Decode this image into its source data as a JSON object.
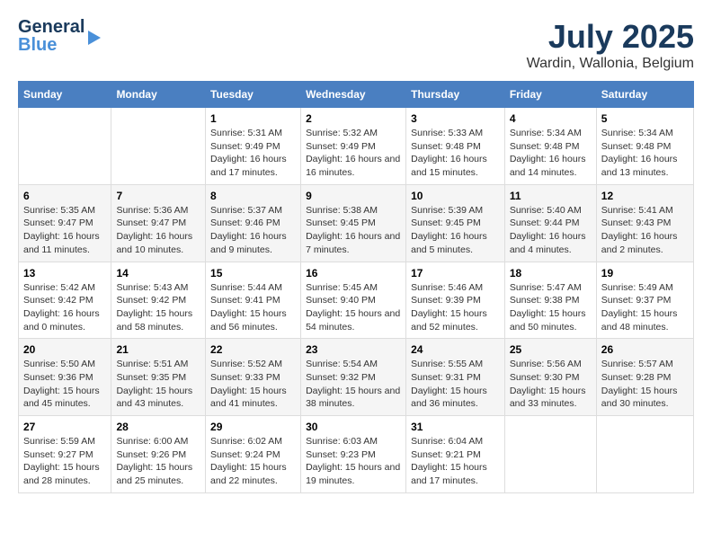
{
  "logo": {
    "general": "General",
    "blue": "Blue"
  },
  "title": "July 2025",
  "subtitle": "Wardin, Wallonia, Belgium",
  "days": [
    "Sunday",
    "Monday",
    "Tuesday",
    "Wednesday",
    "Thursday",
    "Friday",
    "Saturday"
  ],
  "weeks": [
    [
      {
        "day": "",
        "content": ""
      },
      {
        "day": "",
        "content": ""
      },
      {
        "day": "1",
        "content": "Sunrise: 5:31 AM\nSunset: 9:49 PM\nDaylight: 16 hours and 17 minutes."
      },
      {
        "day": "2",
        "content": "Sunrise: 5:32 AM\nSunset: 9:49 PM\nDaylight: 16 hours and 16 minutes."
      },
      {
        "day": "3",
        "content": "Sunrise: 5:33 AM\nSunset: 9:48 PM\nDaylight: 16 hours and 15 minutes."
      },
      {
        "day": "4",
        "content": "Sunrise: 5:34 AM\nSunset: 9:48 PM\nDaylight: 16 hours and 14 minutes."
      },
      {
        "day": "5",
        "content": "Sunrise: 5:34 AM\nSunset: 9:48 PM\nDaylight: 16 hours and 13 minutes."
      }
    ],
    [
      {
        "day": "6",
        "content": "Sunrise: 5:35 AM\nSunset: 9:47 PM\nDaylight: 16 hours and 11 minutes."
      },
      {
        "day": "7",
        "content": "Sunrise: 5:36 AM\nSunset: 9:47 PM\nDaylight: 16 hours and 10 minutes."
      },
      {
        "day": "8",
        "content": "Sunrise: 5:37 AM\nSunset: 9:46 PM\nDaylight: 16 hours and 9 minutes."
      },
      {
        "day": "9",
        "content": "Sunrise: 5:38 AM\nSunset: 9:45 PM\nDaylight: 16 hours and 7 minutes."
      },
      {
        "day": "10",
        "content": "Sunrise: 5:39 AM\nSunset: 9:45 PM\nDaylight: 16 hours and 5 minutes."
      },
      {
        "day": "11",
        "content": "Sunrise: 5:40 AM\nSunset: 9:44 PM\nDaylight: 16 hours and 4 minutes."
      },
      {
        "day": "12",
        "content": "Sunrise: 5:41 AM\nSunset: 9:43 PM\nDaylight: 16 hours and 2 minutes."
      }
    ],
    [
      {
        "day": "13",
        "content": "Sunrise: 5:42 AM\nSunset: 9:42 PM\nDaylight: 16 hours and 0 minutes."
      },
      {
        "day": "14",
        "content": "Sunrise: 5:43 AM\nSunset: 9:42 PM\nDaylight: 15 hours and 58 minutes."
      },
      {
        "day": "15",
        "content": "Sunrise: 5:44 AM\nSunset: 9:41 PM\nDaylight: 15 hours and 56 minutes."
      },
      {
        "day": "16",
        "content": "Sunrise: 5:45 AM\nSunset: 9:40 PM\nDaylight: 15 hours and 54 minutes."
      },
      {
        "day": "17",
        "content": "Sunrise: 5:46 AM\nSunset: 9:39 PM\nDaylight: 15 hours and 52 minutes."
      },
      {
        "day": "18",
        "content": "Sunrise: 5:47 AM\nSunset: 9:38 PM\nDaylight: 15 hours and 50 minutes."
      },
      {
        "day": "19",
        "content": "Sunrise: 5:49 AM\nSunset: 9:37 PM\nDaylight: 15 hours and 48 minutes."
      }
    ],
    [
      {
        "day": "20",
        "content": "Sunrise: 5:50 AM\nSunset: 9:36 PM\nDaylight: 15 hours and 45 minutes."
      },
      {
        "day": "21",
        "content": "Sunrise: 5:51 AM\nSunset: 9:35 PM\nDaylight: 15 hours and 43 minutes."
      },
      {
        "day": "22",
        "content": "Sunrise: 5:52 AM\nSunset: 9:33 PM\nDaylight: 15 hours and 41 minutes."
      },
      {
        "day": "23",
        "content": "Sunrise: 5:54 AM\nSunset: 9:32 PM\nDaylight: 15 hours and 38 minutes."
      },
      {
        "day": "24",
        "content": "Sunrise: 5:55 AM\nSunset: 9:31 PM\nDaylight: 15 hours and 36 minutes."
      },
      {
        "day": "25",
        "content": "Sunrise: 5:56 AM\nSunset: 9:30 PM\nDaylight: 15 hours and 33 minutes."
      },
      {
        "day": "26",
        "content": "Sunrise: 5:57 AM\nSunset: 9:28 PM\nDaylight: 15 hours and 30 minutes."
      }
    ],
    [
      {
        "day": "27",
        "content": "Sunrise: 5:59 AM\nSunset: 9:27 PM\nDaylight: 15 hours and 28 minutes."
      },
      {
        "day": "28",
        "content": "Sunrise: 6:00 AM\nSunset: 9:26 PM\nDaylight: 15 hours and 25 minutes."
      },
      {
        "day": "29",
        "content": "Sunrise: 6:02 AM\nSunset: 9:24 PM\nDaylight: 15 hours and 22 minutes."
      },
      {
        "day": "30",
        "content": "Sunrise: 6:03 AM\nSunset: 9:23 PM\nDaylight: 15 hours and 19 minutes."
      },
      {
        "day": "31",
        "content": "Sunrise: 6:04 AM\nSunset: 9:21 PM\nDaylight: 15 hours and 17 minutes."
      },
      {
        "day": "",
        "content": ""
      },
      {
        "day": "",
        "content": ""
      }
    ]
  ]
}
